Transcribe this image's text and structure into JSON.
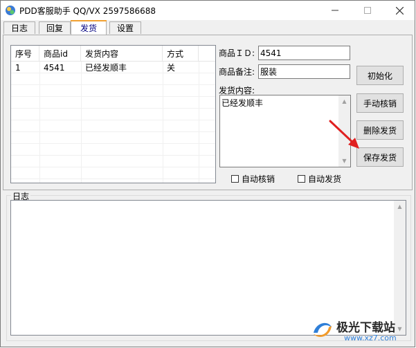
{
  "window": {
    "title": "PDD客服助手 QQ/VX 2597586688",
    "controls": {
      "minimize": "—",
      "maximize": "☐",
      "close": "✕"
    }
  },
  "tabs": [
    {
      "label": "日志",
      "active": false
    },
    {
      "label": "回复",
      "active": false
    },
    {
      "label": "发货",
      "active": true
    },
    {
      "label": "设置",
      "active": false
    }
  ],
  "table": {
    "columns": [
      "序号",
      "商品id",
      "发货内容",
      "方式"
    ],
    "rows": [
      [
        "1",
        "4541",
        "已经发顺丰",
        "关"
      ]
    ]
  },
  "form": {
    "product_id_label": "商品ＩＤ:",
    "product_id_value": "4541",
    "product_note_label": "商品备注:",
    "product_note_value": "服装",
    "content_label": "发货内容:",
    "content_value": "已经发顺丰"
  },
  "buttons": {
    "init": "初始化",
    "manual_verify": "手动核销",
    "delete_ship": "删除发货",
    "save_ship": "保存发货"
  },
  "checkboxes": {
    "auto_verify": {
      "label": "自动核销",
      "checked": false
    },
    "auto_ship": {
      "label": "自动发货",
      "checked": false
    }
  },
  "log_group": {
    "title": "日志"
  },
  "watermark": {
    "brand": "极光下载站",
    "url": "www.xz7.com"
  },
  "colors": {
    "active_tab_accent": "#f0a030",
    "arrow": "#e02020",
    "active_tab_text": "#000080"
  }
}
